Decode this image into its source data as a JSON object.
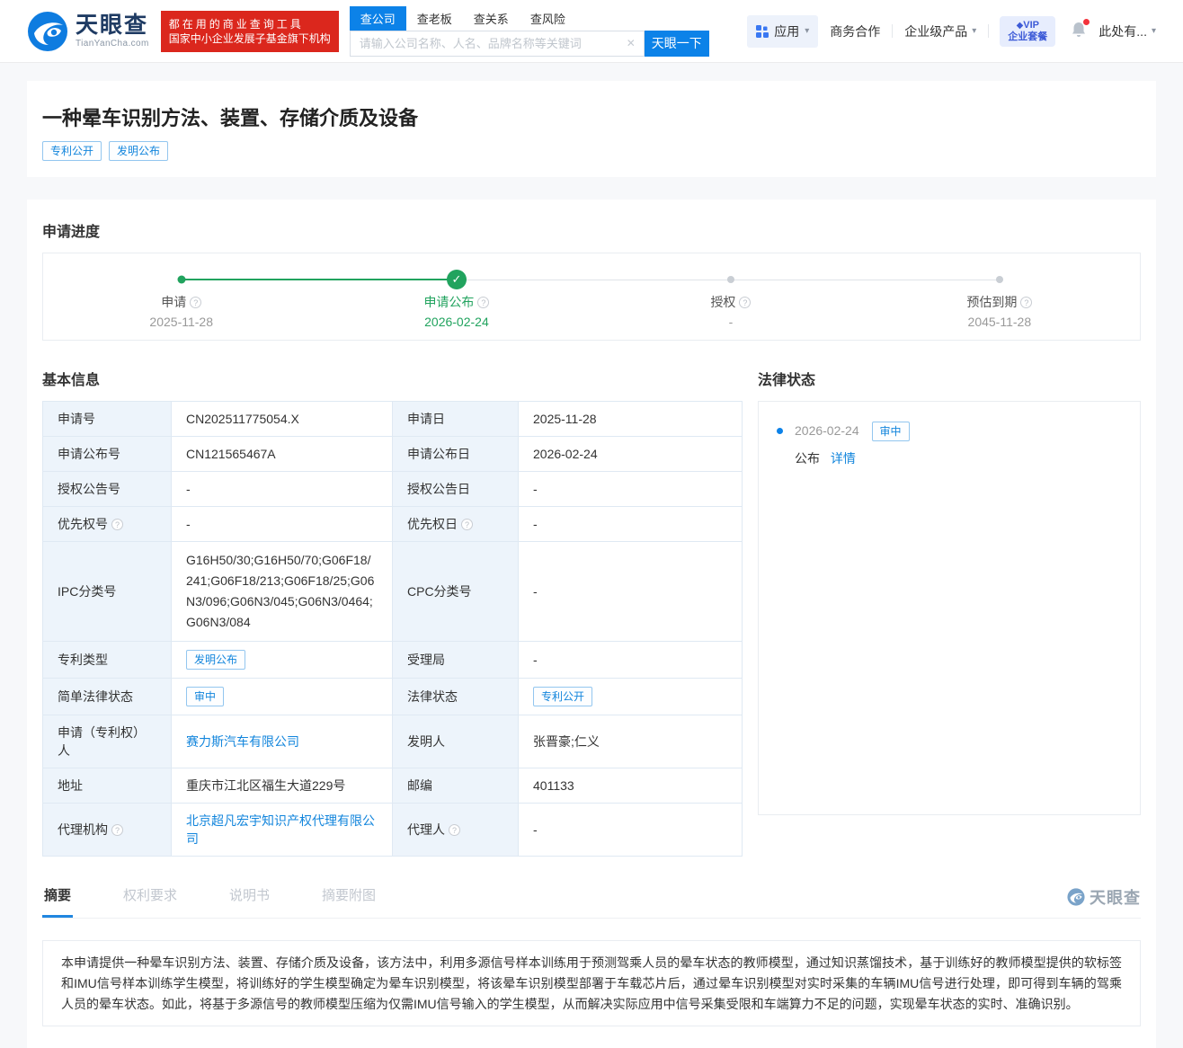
{
  "colors": {
    "brand_blue": "#0c82e8",
    "success_green": "#21a35e",
    "slogan_red": "#db271d",
    "link_blue": "#1285dc"
  },
  "icons": {
    "check": "✓",
    "clear": "✕",
    "caret": "▾",
    "help": "?",
    "vip_diamond": "◆"
  },
  "header": {
    "logo": {
      "title": "天眼查",
      "domain": "TianYanCha.com"
    },
    "slogan": {
      "line1": "都在用的商业查询工具",
      "line2": "国家中小企业发展子基金旗下机构"
    },
    "search": {
      "tabs": [
        {
          "label": "查公司"
        },
        {
          "label": "查老板"
        },
        {
          "label": "查关系"
        },
        {
          "label": "查风险"
        }
      ],
      "placeholder": "请输入公司名称、人名、品牌名称等关键词",
      "button": "天眼一下"
    },
    "nav": {
      "apps": "应用",
      "business": "商务合作",
      "enterprise": "企业级产品",
      "vip_line1": "VIP",
      "vip_line2": "企业套餐",
      "user": "此处有..."
    }
  },
  "page": {
    "title": "一种晕车识别方法、装置、存储介质及设备",
    "tags": [
      "专利公开",
      "发明公布"
    ]
  },
  "progress": {
    "heading": "申请进度",
    "steps": [
      {
        "label": "申请",
        "date": "2025-11-28",
        "status": "completed"
      },
      {
        "label": "申请公布",
        "date": "2026-02-24",
        "status": "current"
      },
      {
        "label": "授权",
        "date": "-",
        "status": "pending"
      },
      {
        "label": "预估到期",
        "date": "2045-11-28",
        "status": "pending"
      }
    ]
  },
  "basic_info": {
    "heading": "基本信息",
    "rows": [
      {
        "label1": "申请号",
        "value1": "CN202511775054.X",
        "label2": "申请日",
        "value2": "2025-11-28"
      },
      {
        "label1": "申请公布号",
        "value1": "CN121565467A",
        "label2": "申请公布日",
        "value2": "2026-02-24"
      },
      {
        "label1": "授权公告号",
        "value1": "-",
        "label2": "授权公告日",
        "value2": "-"
      },
      {
        "label1": "优先权号",
        "value1": "-",
        "label2": "优先权日",
        "value2": "-"
      },
      {
        "label1": "IPC分类号",
        "value1": "G16H50/30;G16H50/70;G06F18/241;G06F18/213;G06F18/25;G06N3/096;G06N3/045;G06N3/0464;G06N3/084",
        "label2": "CPC分类号",
        "value2": "-"
      },
      {
        "label1": "专利类型",
        "value1": "发明公布",
        "label2": "受理局",
        "value2": "-"
      },
      {
        "label1": "简单法律状态",
        "value1": "审中",
        "label2": "法律状态",
        "value2": "专利公开"
      },
      {
        "label1": "申请（专利权）人",
        "value1": "赛力斯汽车有限公司",
        "label2": "发明人",
        "value2": "张晋豪;仁义"
      },
      {
        "label1": "地址",
        "value1": "重庆市江北区福生大道229号",
        "label2": "邮编",
        "value2": "401133"
      },
      {
        "label1": "代理机构",
        "value1": "北京超凡宏宇知识产权代理有限公司",
        "label2": "代理人",
        "value2": "-"
      }
    ]
  },
  "legal_status": {
    "heading": "法律状态",
    "entry": {
      "date": "2026-02-24",
      "badge": "审中",
      "action": "公布",
      "detail_link": "详情"
    }
  },
  "doc_tabs": {
    "items": [
      {
        "label": "摘要"
      },
      {
        "label": "权利要求"
      },
      {
        "label": "说明书"
      },
      {
        "label": "摘要附图"
      }
    ],
    "active": "摘要",
    "watermark": "天眼查"
  },
  "abstract": {
    "text": "本申请提供一种晕车识别方法、装置、存储介质及设备，该方法中，利用多源信号样本训练用于预测驾乘人员的晕车状态的教师模型，通过知识蒸馏技术，基于训练好的教师模型提供的软标签和IMU信号样本训练学生模型，将训练好的学生模型确定为晕车识别模型，将该晕车识别模型部署于车载芯片后，通过晕车识别模型对实时采集的车辆IMU信号进行处理，即可得到车辆的驾乘人员的晕车状态。如此，将基于多源信号的教师模型压缩为仅需IMU信号输入的学生模型，从而解决实际应用中信号采集受限和车端算力不足的问题，实现晕车状态的实时、准确识别。"
  }
}
